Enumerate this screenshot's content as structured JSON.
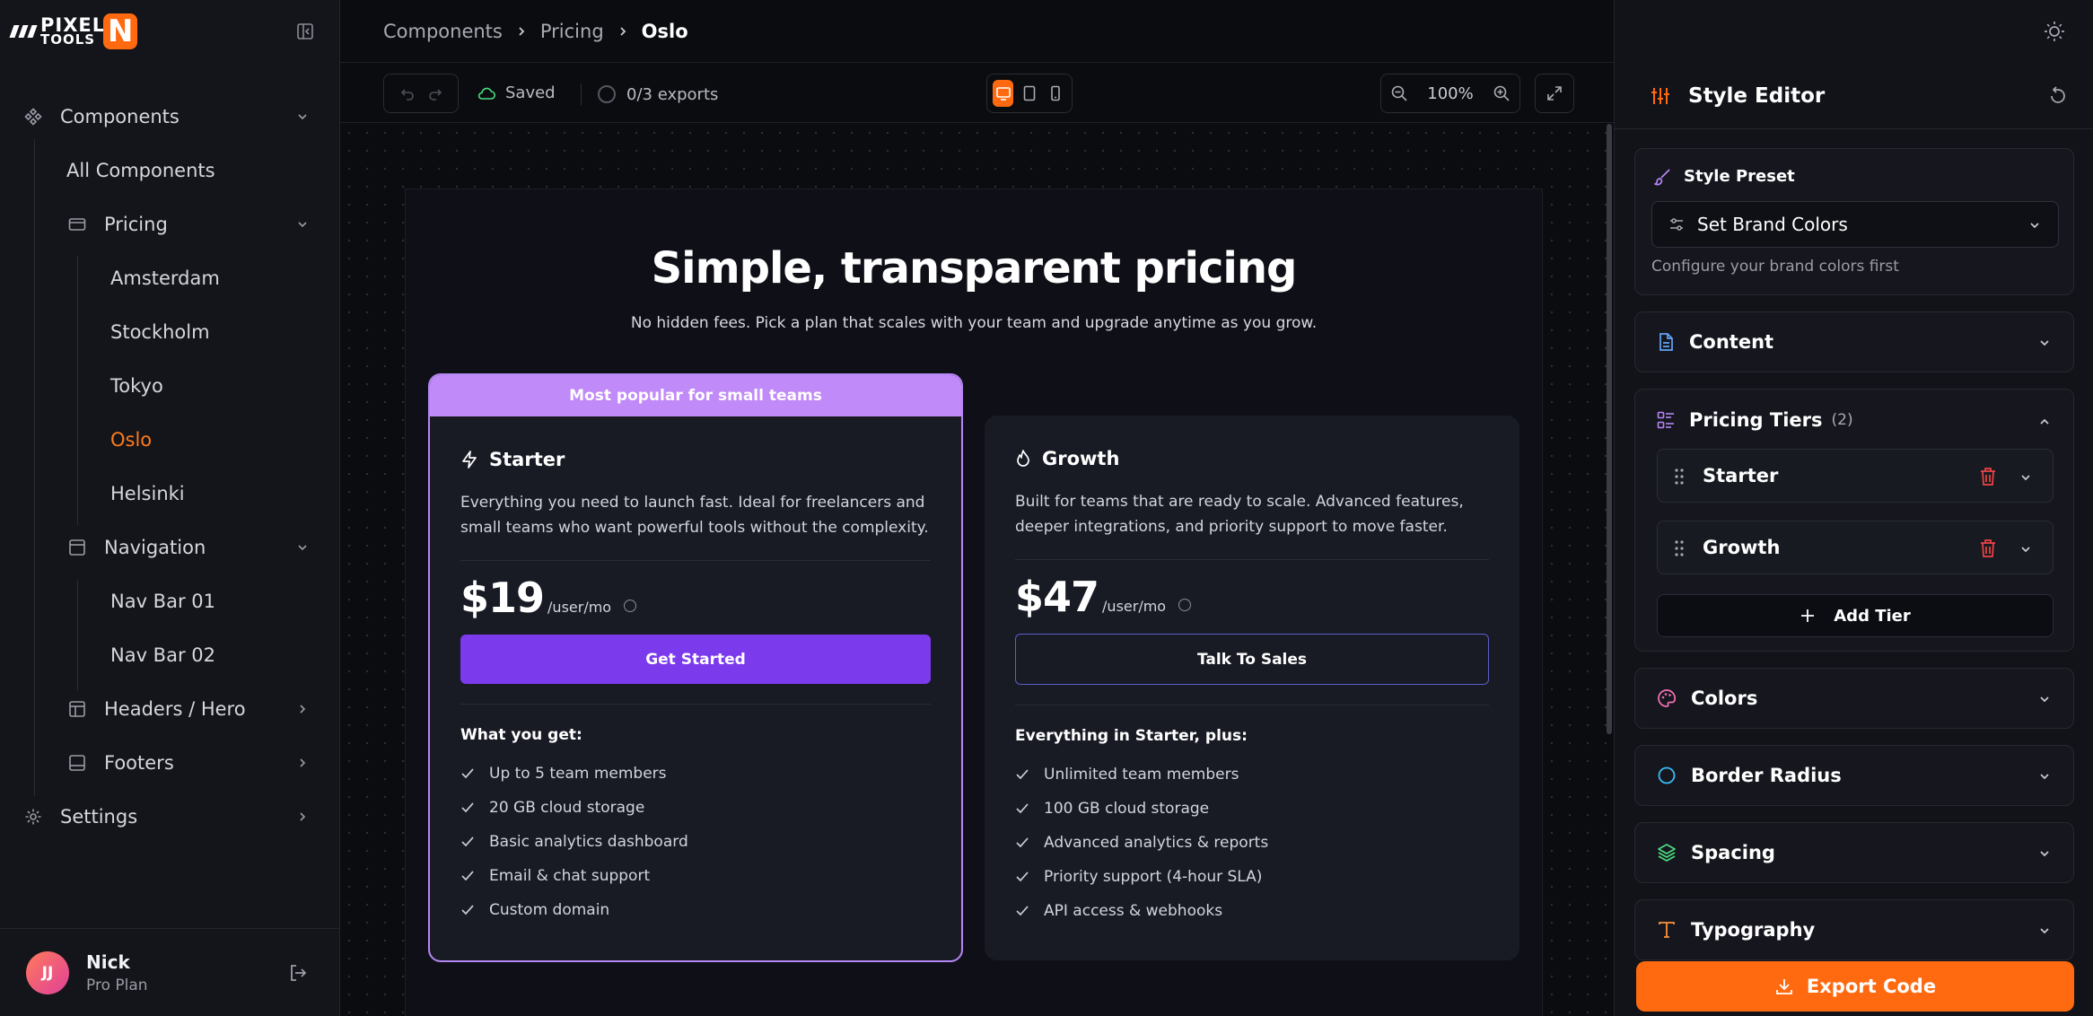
{
  "brand": {
    "logo_line1": "PIXEL",
    "logo_line2": "TOOLS",
    "logo_mark": "N",
    "accent": "#ff6a10"
  },
  "sidebar": {
    "items": [
      {
        "label": "Components",
        "icon": "components-icon"
      },
      {
        "label": "All Components"
      },
      {
        "label": "Pricing",
        "icon": "card-icon"
      },
      {
        "label": "Amsterdam"
      },
      {
        "label": "Stockholm"
      },
      {
        "label": "Tokyo"
      },
      {
        "label": "Oslo",
        "active": true
      },
      {
        "label": "Helsinki"
      },
      {
        "label": "Navigation",
        "icon": "window-icon"
      },
      {
        "label": "Nav Bar 01"
      },
      {
        "label": "Nav Bar 02"
      },
      {
        "label": "Headers / Hero",
        "icon": "layout-icon"
      },
      {
        "label": "Footers",
        "icon": "footer-icon"
      },
      {
        "label": "Settings",
        "icon": "gear-icon"
      }
    ],
    "user": {
      "initials": "JJ",
      "name": "Nick",
      "plan": "Pro Plan"
    }
  },
  "breadcrumb": [
    "Components",
    "Pricing",
    "Oslo"
  ],
  "toolbar": {
    "saved_label": "Saved",
    "exports_label": "0/3 exports",
    "zoom": "100%"
  },
  "preview": {
    "title": "Simple, transparent pricing",
    "subtitle": "No hidden fees. Pick a plan that scales with your team and upgrade anytime as you grow.",
    "plans": [
      {
        "ribbon": "Most popular for small teams",
        "name": "Starter",
        "icon": "bolt-icon",
        "description": "Everything you need to launch fast. Ideal for freelancers and small teams who want powerful tools without the complexity.",
        "price": "$19",
        "period": "/user/mo",
        "cta": "Get Started",
        "features_title": "What you get:",
        "features": [
          "Up to 5 team members",
          "20 GB cloud storage",
          "Basic analytics dashboard",
          "Email & chat support",
          "Custom domain"
        ]
      },
      {
        "name": "Growth",
        "icon": "flame-icon",
        "description": "Built for teams that are ready to scale. Advanced features, deeper integrations, and priority support to move faster.",
        "price": "$47",
        "period": "/user/mo",
        "cta": "Talk To Sales",
        "features_title": "Everything in Starter, plus:",
        "features": [
          "Unlimited team members",
          "100 GB cloud storage",
          "Advanced analytics & reports",
          "Priority support (4-hour SLA)",
          "API access & webhooks"
        ]
      }
    ]
  },
  "panel": {
    "title": "Style Editor",
    "preset_label": "Style Preset",
    "preset_value": "Set Brand Colors",
    "preset_hint": "Configure your brand colors first",
    "sections": [
      "Content",
      "Colors",
      "Border Radius",
      "Spacing",
      "Typography"
    ],
    "tiers_label": "Pricing Tiers",
    "tiers_count": "(2)",
    "tiers": [
      "Starter",
      "Growth"
    ],
    "add_tier": "Add Tier",
    "export": "Export Code"
  }
}
